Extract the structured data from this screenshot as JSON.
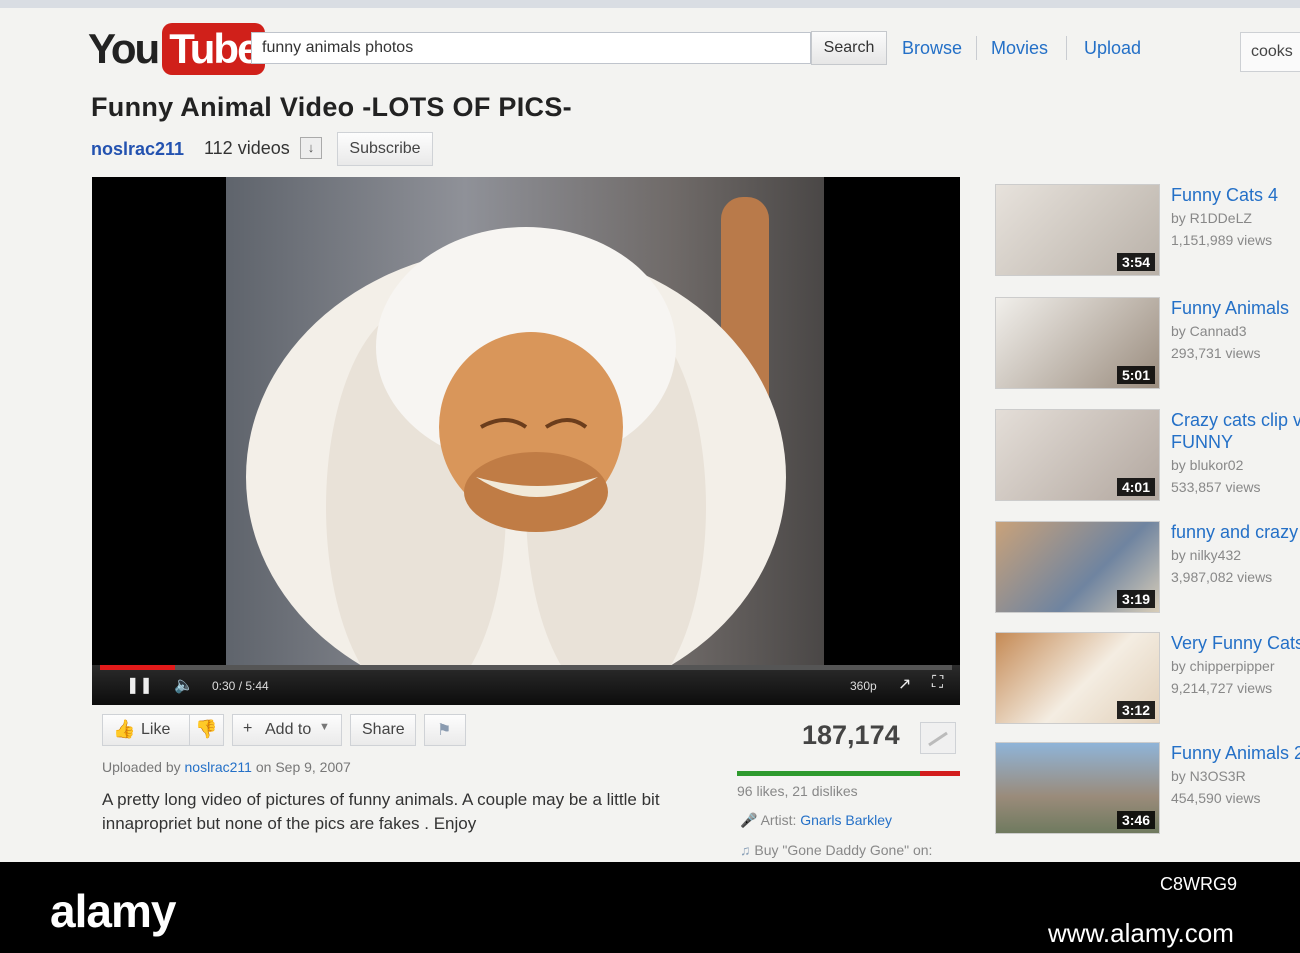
{
  "header": {
    "logo_you": "You",
    "logo_tube": "Tube",
    "search_value": "funny animals photos",
    "search_button": "Search",
    "nav": [
      "Browse",
      "Movies",
      "Upload"
    ],
    "user": "cooks"
  },
  "video": {
    "title": "Funny Animal Video -LOTS OF PICS-",
    "channel": "noslrac211",
    "videos_count": "112 videos",
    "subscribe_label": "Subscribe",
    "time": "0:30 / 5:44",
    "quality": "360p",
    "progress_fraction": 0.088
  },
  "actions": {
    "like": "Like",
    "add_to": "Add to",
    "share": "Share"
  },
  "stats": {
    "views": "187,174",
    "likes_text": "96 likes, 21 dislikes",
    "like_fraction": 0.82
  },
  "upload": {
    "prefix": "Uploaded by",
    "user": "noslrac211",
    "date": "on Sep 9, 2007"
  },
  "description": "A pretty long video of pictures of funny animals. A couple may be a little bit innapropriet but none of the pics are fakes . Enjoy",
  "meta": {
    "artist_label": "Artist:",
    "artist_name": "Gnarls Barkley",
    "buy_text": "Buy \"Gone Daddy Gone\" on:"
  },
  "sidebar": [
    {
      "title": "Funny Cats 4",
      "by": "by R1DDeLZ",
      "views": "1,151,989 views",
      "duration": "3:54"
    },
    {
      "title": "Funny Animals",
      "by": "by Cannad3",
      "views": "293,731 views",
      "duration": "5:01"
    },
    {
      "title": "Crazy cats clip v FUNNY",
      "by": "by blukor02",
      "views": "533,857 views",
      "duration": "4:01"
    },
    {
      "title": "funny and crazy",
      "by": "by nilky432",
      "views": "3,987,082 views",
      "duration": "3:19"
    },
    {
      "title": "Very Funny Cats",
      "by": "by chipperpipper",
      "views": "9,214,727 views",
      "duration": "3:12"
    },
    {
      "title": "Funny Animals 2",
      "by": "by N3OS3R",
      "views": "454,590 views",
      "duration": "3:46"
    }
  ],
  "watermark": {
    "brand": "alamy",
    "code": "C8WRG9",
    "url": "www.alamy.com"
  },
  "colors": {
    "link": "#2470c7",
    "youtube_red": "#d0201a",
    "like_green": "#2e9a2e",
    "dislike_red": "#d21d1d"
  }
}
